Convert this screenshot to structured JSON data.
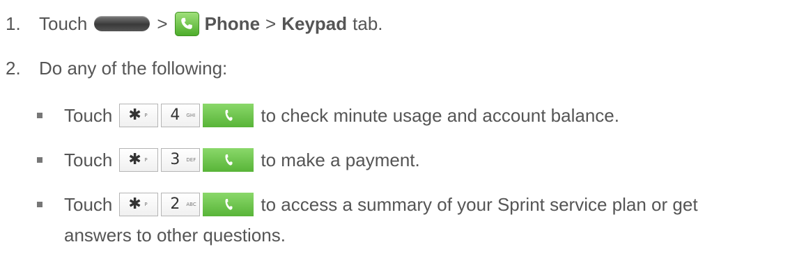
{
  "step1": {
    "number": "1.",
    "touch": "Touch",
    "sep1": ">",
    "phone": "Phone",
    "sep2": ">",
    "keypad": "Keypad",
    "tab": "tab."
  },
  "step2": {
    "number": "2.",
    "text": "Do any of the following:"
  },
  "bullets": [
    {
      "touch": "Touch",
      "keys": [
        {
          "main": "✱",
          "sub": "P"
        },
        {
          "main": "4",
          "sub": "GHI"
        }
      ],
      "text": "to check minute usage and account balance."
    },
    {
      "touch": "Touch",
      "keys": [
        {
          "main": "✱",
          "sub": "P"
        },
        {
          "main": "3",
          "sub": "DEF"
        }
      ],
      "text": "to make a payment."
    },
    {
      "touch": "Touch",
      "keys": [
        {
          "main": "✱",
          "sub": "P"
        },
        {
          "main": "2",
          "sub": "ABC"
        }
      ],
      "text": "to access a summary of your Sprint service plan or get",
      "text_cont": "answers to other questions."
    }
  ],
  "icons": {
    "home_key": "home-key-icon",
    "phone_app": "phone-app-icon",
    "call_key": "call-key-icon"
  },
  "colors": {
    "text": "#555555",
    "call_green": "#58b438"
  }
}
